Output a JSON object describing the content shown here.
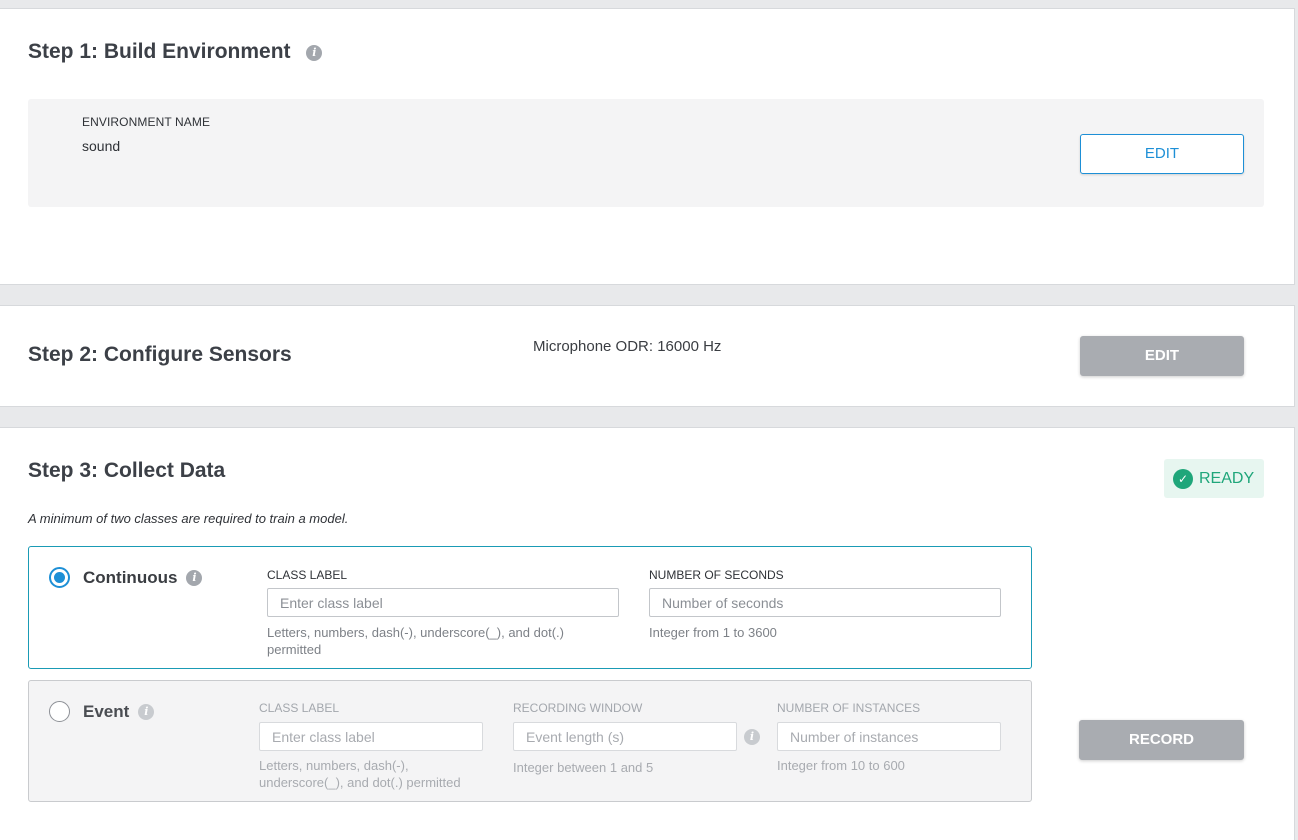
{
  "step1": {
    "title": "Step 1: Build Environment",
    "env_label": "ENVIRONMENT NAME",
    "env_value": "sound",
    "edit_label": "EDIT"
  },
  "step2": {
    "title": "Step 2: Configure Sensors",
    "sensor_info": "Microphone ODR: 16000 Hz",
    "edit_label": "EDIT"
  },
  "step3": {
    "title": "Step 3: Collect Data",
    "status": "READY",
    "note": "A minimum of two classes are required to train a model.",
    "continuous": {
      "label": "Continuous",
      "selected": true,
      "class_label": {
        "label": "CLASS LABEL",
        "placeholder": "Enter class label",
        "value": "",
        "hint": "Letters, numbers, dash(-), underscore(_), and dot(.) permitted"
      },
      "seconds": {
        "label": "NUMBER OF SECONDS",
        "placeholder": "Number of seconds",
        "value": "",
        "hint": "Integer from 1 to 3600"
      }
    },
    "event": {
      "label": "Event",
      "selected": false,
      "class_label": {
        "label": "CLASS LABEL",
        "placeholder": "Enter class label",
        "value": "",
        "hint": "Letters, numbers, dash(-), underscore(_), and dot(.) permitted"
      },
      "window": {
        "label": "RECORDING WINDOW",
        "placeholder": "Event length (s)",
        "value": "",
        "hint": "Integer between 1 and 5"
      },
      "instances": {
        "label": "NUMBER OF INSTANCES",
        "placeholder": "Number of instances",
        "value": "",
        "hint": "Integer from 10 to 600"
      }
    },
    "record_label": "RECORD"
  },
  "colors": {
    "accent_blue": "#1d8fd6",
    "ready_green": "#1fa67a",
    "disabled_grey": "#a9acb1",
    "selected_border": "#1a9bb5"
  },
  "icons": {
    "info": "info-icon",
    "ready": "check-circle-icon"
  }
}
